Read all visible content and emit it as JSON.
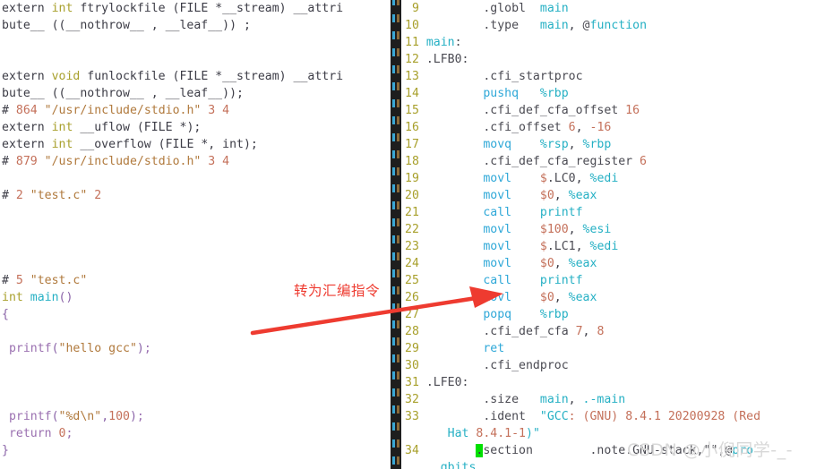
{
  "left_pane": {
    "name": "preprocessed-c-source",
    "lines": [
      {
        "tokens": [
          {
            "t": "extern ",
            "c": "plain"
          },
          {
            "t": "int",
            "c": "type"
          },
          {
            "t": " ftrylockfile (FILE *__stream) __attri",
            "c": "plain"
          }
        ]
      },
      {
        "tokens": [
          {
            "t": "bute__ ((__nothrow__ , __leaf__)) ;",
            "c": "plain"
          }
        ]
      },
      {
        "tokens": []
      },
      {
        "tokens": []
      },
      {
        "tokens": [
          {
            "t": "extern ",
            "c": "plain"
          },
          {
            "t": "void",
            "c": "type"
          },
          {
            "t": " funlockfile (FILE *__stream) __attri",
            "c": "plain"
          }
        ]
      },
      {
        "tokens": [
          {
            "t": "bute__ ((__nothrow__ , __leaf__));",
            "c": "plain"
          }
        ]
      },
      {
        "tokens": [
          {
            "t": "# ",
            "c": "plain"
          },
          {
            "t": "864",
            "c": "num"
          },
          {
            "t": " ",
            "c": "plain"
          },
          {
            "t": "\"/usr/include/stdio.h\"",
            "c": "str"
          },
          {
            "t": " ",
            "c": "plain"
          },
          {
            "t": "3 4",
            "c": "num"
          }
        ]
      },
      {
        "tokens": [
          {
            "t": "extern ",
            "c": "plain"
          },
          {
            "t": "int",
            "c": "type"
          },
          {
            "t": " __uflow (FILE *);",
            "c": "plain"
          }
        ]
      },
      {
        "tokens": [
          {
            "t": "extern ",
            "c": "plain"
          },
          {
            "t": "int",
            "c": "type"
          },
          {
            "t": " __overflow (FILE *, int);",
            "c": "plain"
          }
        ]
      },
      {
        "tokens": [
          {
            "t": "# ",
            "c": "plain"
          },
          {
            "t": "879",
            "c": "num"
          },
          {
            "t": " ",
            "c": "plain"
          },
          {
            "t": "\"/usr/include/stdio.h\"",
            "c": "str"
          },
          {
            "t": " ",
            "c": "plain"
          },
          {
            "t": "3 4",
            "c": "num"
          }
        ]
      },
      {
        "tokens": []
      },
      {
        "tokens": [
          {
            "t": "# ",
            "c": "plain"
          },
          {
            "t": "2",
            "c": "num"
          },
          {
            "t": " ",
            "c": "plain"
          },
          {
            "t": "\"test.c\"",
            "c": "str"
          },
          {
            "t": " ",
            "c": "plain"
          },
          {
            "t": "2",
            "c": "num"
          }
        ]
      },
      {
        "tokens": []
      },
      {
        "tokens": []
      },
      {
        "tokens": []
      },
      {
        "tokens": []
      },
      {
        "tokens": [
          {
            "t": "# ",
            "c": "plain"
          },
          {
            "t": "5",
            "c": "num"
          },
          {
            "t": " ",
            "c": "plain"
          },
          {
            "t": "\"test.c\"",
            "c": "str"
          }
        ]
      },
      {
        "tokens": [
          {
            "t": "int",
            "c": "type"
          },
          {
            "t": " ",
            "c": "plain"
          },
          {
            "t": "main",
            "c": "ident"
          },
          {
            "t": "()",
            "c": "punct"
          }
        ]
      },
      {
        "tokens": [
          {
            "t": "{",
            "c": "punct"
          }
        ]
      },
      {
        "tokens": []
      },
      {
        "tokens": [
          {
            "t": " ",
            "c": "plain"
          },
          {
            "t": "printf",
            "c": "fn"
          },
          {
            "t": "(",
            "c": "punct"
          },
          {
            "t": "\"hello gcc\"",
            "c": "str"
          },
          {
            "t": ")",
            "c": "punct"
          },
          {
            "t": ";",
            "c": "fn"
          }
        ]
      },
      {
        "tokens": []
      },
      {
        "tokens": []
      },
      {
        "tokens": []
      },
      {
        "tokens": [
          {
            "t": " ",
            "c": "plain"
          },
          {
            "t": "printf",
            "c": "fn"
          },
          {
            "t": "(",
            "c": "punct"
          },
          {
            "t": "\"%d\\n\"",
            "c": "str"
          },
          {
            "t": ",",
            "c": "punct"
          },
          {
            "t": "100",
            "c": "num"
          },
          {
            "t": ")",
            "c": "punct"
          },
          {
            "t": ";",
            "c": "fn"
          }
        ]
      },
      {
        "tokens": [
          {
            "t": " ",
            "c": "plain"
          },
          {
            "t": "return",
            "c": "fn"
          },
          {
            "t": " ",
            "c": "plain"
          },
          {
            "t": "0",
            "c": "num"
          },
          {
            "t": ";",
            "c": "fn"
          }
        ]
      },
      {
        "tokens": [
          {
            "t": "}",
            "c": "punct"
          }
        ]
      }
    ]
  },
  "right_pane": {
    "name": "generated-assembly",
    "lines": [
      {
        "num": "9",
        "tokens": [
          {
            "t": "        ",
            "c": "plain"
          },
          {
            "t": ".globl",
            "c": "dir"
          },
          {
            "t": "  ",
            "c": "plain"
          },
          {
            "t": "main",
            "c": "ident"
          }
        ]
      },
      {
        "num": "10",
        "tokens": [
          {
            "t": "        ",
            "c": "plain"
          },
          {
            "t": ".type",
            "c": "dir"
          },
          {
            "t": "   ",
            "c": "plain"
          },
          {
            "t": "main",
            "c": "ident"
          },
          {
            "t": ", ",
            "c": "plain"
          },
          {
            "t": "@",
            "c": "dir"
          },
          {
            "t": "function",
            "c": "ident"
          }
        ]
      },
      {
        "num": "11",
        "tokens": [
          {
            "t": "main",
            "c": "ident"
          },
          {
            "t": ":",
            "c": "dir"
          }
        ]
      },
      {
        "num": "12",
        "tokens": [
          {
            "t": ".LFB0:",
            "c": "dir"
          }
        ]
      },
      {
        "num": "13",
        "tokens": [
          {
            "t": "        ",
            "c": "plain"
          },
          {
            "t": ".cfi_startproc",
            "c": "dir"
          }
        ]
      },
      {
        "num": "14",
        "tokens": [
          {
            "t": "        ",
            "c": "plain"
          },
          {
            "t": "pushq",
            "c": "mnem"
          },
          {
            "t": "   ",
            "c": "plain"
          },
          {
            "t": "%rbp",
            "c": "ident"
          }
        ]
      },
      {
        "num": "15",
        "tokens": [
          {
            "t": "        ",
            "c": "plain"
          },
          {
            "t": ".cfi_def_cfa_offset",
            "c": "dir"
          },
          {
            "t": " ",
            "c": "plain"
          },
          {
            "t": "16",
            "c": "num"
          }
        ]
      },
      {
        "num": "16",
        "tokens": [
          {
            "t": "        ",
            "c": "plain"
          },
          {
            "t": ".cfi_offset",
            "c": "dir"
          },
          {
            "t": " ",
            "c": "plain"
          },
          {
            "t": "6",
            "c": "num"
          },
          {
            "t": ", ",
            "c": "plain"
          },
          {
            "t": "-16",
            "c": "num"
          }
        ]
      },
      {
        "num": "17",
        "tokens": [
          {
            "t": "        ",
            "c": "plain"
          },
          {
            "t": "movq",
            "c": "mnem"
          },
          {
            "t": "    ",
            "c": "plain"
          },
          {
            "t": "%rsp",
            "c": "ident"
          },
          {
            "t": ", ",
            "c": "plain"
          },
          {
            "t": "%rbp",
            "c": "ident"
          }
        ]
      },
      {
        "num": "18",
        "tokens": [
          {
            "t": "        ",
            "c": "plain"
          },
          {
            "t": ".cfi_def_cfa_register",
            "c": "dir"
          },
          {
            "t": " ",
            "c": "plain"
          },
          {
            "t": "6",
            "c": "num"
          }
        ]
      },
      {
        "num": "19",
        "tokens": [
          {
            "t": "        ",
            "c": "plain"
          },
          {
            "t": "movl",
            "c": "mnem"
          },
          {
            "t": "    ",
            "c": "plain"
          },
          {
            "t": "$",
            "c": "num"
          },
          {
            "t": ".LC0",
            "c": "dir"
          },
          {
            "t": ", ",
            "c": "plain"
          },
          {
            "t": "%edi",
            "c": "ident"
          }
        ]
      },
      {
        "num": "20",
        "tokens": [
          {
            "t": "        ",
            "c": "plain"
          },
          {
            "t": "movl",
            "c": "mnem"
          },
          {
            "t": "    ",
            "c": "plain"
          },
          {
            "t": "$0",
            "c": "num"
          },
          {
            "t": ", ",
            "c": "plain"
          },
          {
            "t": "%eax",
            "c": "ident"
          }
        ]
      },
      {
        "num": "21",
        "tokens": [
          {
            "t": "        ",
            "c": "plain"
          },
          {
            "t": "call",
            "c": "mnem"
          },
          {
            "t": "    ",
            "c": "plain"
          },
          {
            "t": "printf",
            "c": "ident"
          }
        ]
      },
      {
        "num": "22",
        "tokens": [
          {
            "t": "        ",
            "c": "plain"
          },
          {
            "t": "movl",
            "c": "mnem"
          },
          {
            "t": "    ",
            "c": "plain"
          },
          {
            "t": "$100",
            "c": "num"
          },
          {
            "t": ", ",
            "c": "plain"
          },
          {
            "t": "%esi",
            "c": "ident"
          }
        ]
      },
      {
        "num": "23",
        "tokens": [
          {
            "t": "        ",
            "c": "plain"
          },
          {
            "t": "movl",
            "c": "mnem"
          },
          {
            "t": "    ",
            "c": "plain"
          },
          {
            "t": "$",
            "c": "num"
          },
          {
            "t": ".LC1",
            "c": "dir"
          },
          {
            "t": ", ",
            "c": "plain"
          },
          {
            "t": "%edi",
            "c": "ident"
          }
        ]
      },
      {
        "num": "24",
        "tokens": [
          {
            "t": "        ",
            "c": "plain"
          },
          {
            "t": "movl",
            "c": "mnem"
          },
          {
            "t": "    ",
            "c": "plain"
          },
          {
            "t": "$0",
            "c": "num"
          },
          {
            "t": ", ",
            "c": "plain"
          },
          {
            "t": "%eax",
            "c": "ident"
          }
        ]
      },
      {
        "num": "25",
        "tokens": [
          {
            "t": "        ",
            "c": "plain"
          },
          {
            "t": "call",
            "c": "mnem"
          },
          {
            "t": "    ",
            "c": "plain"
          },
          {
            "t": "printf",
            "c": "ident"
          }
        ]
      },
      {
        "num": "26",
        "tokens": [
          {
            "t": "        ",
            "c": "plain"
          },
          {
            "t": "movl",
            "c": "mnem"
          },
          {
            "t": "    ",
            "c": "plain"
          },
          {
            "t": "$0",
            "c": "num"
          },
          {
            "t": ", ",
            "c": "plain"
          },
          {
            "t": "%eax",
            "c": "ident"
          }
        ]
      },
      {
        "num": "27",
        "tokens": [
          {
            "t": "        ",
            "c": "plain"
          },
          {
            "t": "popq",
            "c": "mnem"
          },
          {
            "t": "    ",
            "c": "plain"
          },
          {
            "t": "%rbp",
            "c": "ident"
          }
        ]
      },
      {
        "num": "28",
        "tokens": [
          {
            "t": "        ",
            "c": "plain"
          },
          {
            "t": ".cfi_def_cfa",
            "c": "dir"
          },
          {
            "t": " ",
            "c": "plain"
          },
          {
            "t": "7",
            "c": "num"
          },
          {
            "t": ", ",
            "c": "plain"
          },
          {
            "t": "8",
            "c": "num"
          }
        ]
      },
      {
        "num": "29",
        "tokens": [
          {
            "t": "        ",
            "c": "plain"
          },
          {
            "t": "ret",
            "c": "mnem"
          }
        ]
      },
      {
        "num": "30",
        "tokens": [
          {
            "t": "        ",
            "c": "plain"
          },
          {
            "t": ".cfi_endproc",
            "c": "dir"
          }
        ]
      },
      {
        "num": "31",
        "tokens": [
          {
            "t": ".LFE0:",
            "c": "dir"
          }
        ]
      },
      {
        "num": "32",
        "tokens": [
          {
            "t": "        ",
            "c": "plain"
          },
          {
            "t": ".size",
            "c": "dir"
          },
          {
            "t": "   ",
            "c": "plain"
          },
          {
            "t": "main",
            "c": "ident"
          },
          {
            "t": ", ",
            "c": "plain"
          },
          {
            "t": ".-main",
            "c": "ident"
          }
        ]
      },
      {
        "num": "33",
        "tokens": [
          {
            "t": "        ",
            "c": "plain"
          },
          {
            "t": ".ident",
            "c": "dir"
          },
          {
            "t": "  ",
            "c": "plain"
          },
          {
            "t": "\"GCC",
            "c": "ident"
          },
          {
            "t": ": (GNU) ",
            "c": "num"
          },
          {
            "t": "8.4.1 20200928",
            "c": "num"
          },
          {
            "t": " (Red",
            "c": "num"
          }
        ]
      },
      {
        "num": "",
        "tokens": [
          {
            "t": "   ",
            "c": "plain"
          },
          {
            "t": "Hat ",
            "c": "ident"
          },
          {
            "t": "8.4.1-1",
            "c": "num"
          },
          {
            "t": ")\"",
            "c": "ident"
          }
        ]
      },
      {
        "num": "34",
        "tokens": [
          {
            "t": "       ",
            "c": "plain"
          },
          {
            "t": ".",
            "c": "cursor"
          },
          {
            "t": "section",
            "c": "dir"
          },
          {
            "t": "        ",
            "c": "plain"
          },
          {
            "t": ".note.GNU-stack,\"\",",
            "c": "dir"
          },
          {
            "t": "@",
            "c": "dir"
          },
          {
            "t": "pro",
            "c": "ident"
          }
        ]
      },
      {
        "num": "",
        "tokens": [
          {
            "t": "  ",
            "c": "plain"
          },
          {
            "t": "gbits",
            "c": "ident"
          }
        ]
      }
    ]
  },
  "annotation": {
    "text": "转为汇编指令",
    "color": "#ee3b30",
    "arrow": "red-arrow-pointing-right"
  },
  "watermark": {
    "text": "CSDN @小倪同学-_-",
    "color": "#d8d8d8"
  }
}
